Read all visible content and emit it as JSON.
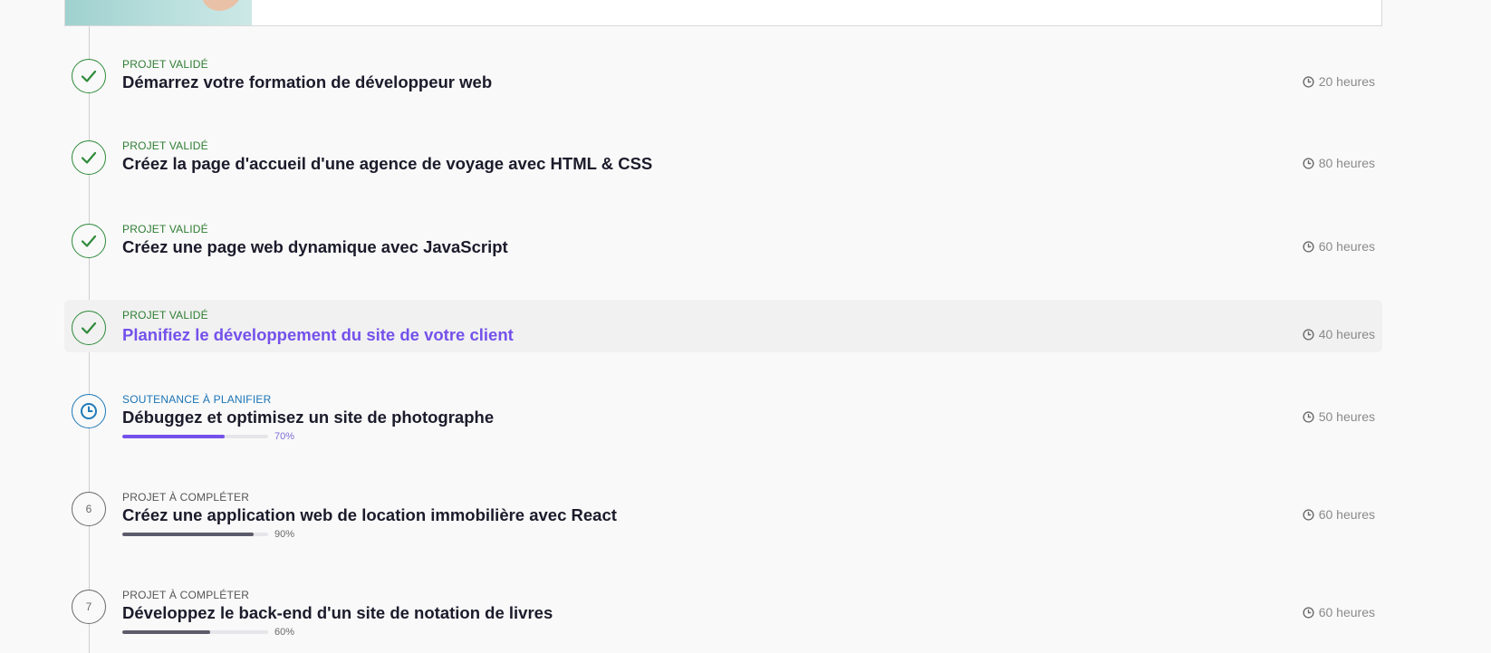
{
  "projects": [
    {
      "status": "PROJET VALIDÉ",
      "title": "Démarrez votre formation de développeur web",
      "duration": "20 heures",
      "icon": "check-icon"
    },
    {
      "status": "PROJET VALIDÉ",
      "title": "Créez la page d'accueil d'une agence de voyage avec HTML & CSS",
      "duration": "80 heures",
      "icon": "check-icon"
    },
    {
      "status": "PROJET VALIDÉ",
      "title": "Créez une page web dynamique avec JavaScript",
      "duration": "60 heures",
      "icon": "check-icon"
    },
    {
      "status": "PROJET VALIDÉ",
      "title": "Planifiez le développement du site de votre client",
      "duration": "40 heures",
      "icon": "check-icon",
      "active": true
    },
    {
      "status": "SOUTENANCE À PLANIFIER",
      "title": "Débuggez et optimisez un site de photographe",
      "duration": "50 heures",
      "icon": "clock-icon",
      "progress": 70,
      "progress_label": "70%"
    },
    {
      "status": "PROJET À COMPLÉTER",
      "title": "Créez une application web de location immobilière avec React",
      "duration": "60 heures",
      "number": "6",
      "progress": 90,
      "progress_label": "90%"
    },
    {
      "status": "PROJET À COMPLÉTER",
      "title": "Développez le back-end d'un site de notation de livres",
      "duration": "60 heures",
      "number": "7",
      "progress": 60,
      "progress_label": "60%"
    }
  ],
  "colors": {
    "validated": "#2e7d32",
    "pending": "#1a73b5",
    "active_title": "#7451eb",
    "progress_pending": "#7451eb",
    "progress_todo": "#5b5b6b"
  }
}
